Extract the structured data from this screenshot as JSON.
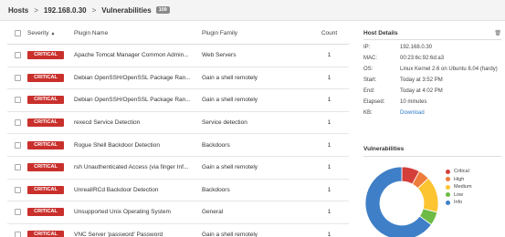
{
  "breadcrumb": {
    "hosts": "Hosts",
    "ip": "192.168.0.30",
    "current": "Vulnerabilities",
    "count_badge": "109"
  },
  "table": {
    "headers": {
      "severity": "Severity",
      "plugin_name": "Plugin Name",
      "plugin_family": "Plugin Family",
      "count": "Count"
    },
    "rows": [
      {
        "severity": "CRITICAL",
        "name": "Apache Tomcat Manager Common Admin...",
        "family": "Web Servers",
        "count": "1"
      },
      {
        "severity": "CRITICAL",
        "name": "Debian OpenSSH/OpenSSL Package Ran...",
        "family": "Gain a shell remotely",
        "count": "1"
      },
      {
        "severity": "CRITICAL",
        "name": "Debian OpenSSH/OpenSSL Package Ran...",
        "family": "Gain a shell remotely",
        "count": "1"
      },
      {
        "severity": "CRITICAL",
        "name": "rexecd Service Detection",
        "family": "Service detection",
        "count": "1"
      },
      {
        "severity": "CRITICAL",
        "name": "Rogue Shell Backdoor Detection",
        "family": "Backdoors",
        "count": "1"
      },
      {
        "severity": "CRITICAL",
        "name": "rsh Unauthenticated Access (via finger Inf...",
        "family": "Gain a shell remotely",
        "count": "1"
      },
      {
        "severity": "CRITICAL",
        "name": "UnrealIRCd Backdoor Detection",
        "family": "Backdoors",
        "count": "1"
      },
      {
        "severity": "CRITICAL",
        "name": "Unsupported Unix Operating System",
        "family": "General",
        "count": "1"
      },
      {
        "severity": "CRITICAL",
        "name": "VNC Server 'password' Password",
        "family": "Gain a shell remotely",
        "count": "1"
      }
    ]
  },
  "host_details": {
    "title": "Host Details",
    "fields": [
      {
        "key": "IP:",
        "value": "192.168.0.30"
      },
      {
        "key": "MAC:",
        "value": "00:23:6c:92:6d:a3"
      },
      {
        "key": "OS:",
        "value": "Linux Kernel 2.6 on Ubuntu 8.04 (hardy)"
      },
      {
        "key": "Start:",
        "value": "Today at 3:52 PM"
      },
      {
        "key": "End:",
        "value": "Today at 4:02 PM"
      },
      {
        "key": "Elapsed:",
        "value": "10 minutes"
      },
      {
        "key": "KB:",
        "value": "Download"
      }
    ]
  },
  "vulnerabilities": {
    "title": "Vulnerabilities",
    "legend": [
      {
        "label": "Critical",
        "color": "#d43f3a"
      },
      {
        "label": "High",
        "color": "#ee7d3b"
      },
      {
        "label": "Medium",
        "color": "#fdc431"
      },
      {
        "label": "Low",
        "color": "#6dbb44"
      },
      {
        "label": "Info",
        "color": "#3f7fc7"
      }
    ]
  },
  "chart_data": {
    "type": "pie",
    "title": "Vulnerabilities",
    "categories": [
      "Critical",
      "High",
      "Medium",
      "Low",
      "Info"
    ],
    "values": [
      8,
      5,
      16,
      6,
      65
    ],
    "colors": [
      "#d43f3a",
      "#ee7d3b",
      "#fdc431",
      "#6dbb44",
      "#3f7fc7"
    ],
    "legend": "right"
  }
}
